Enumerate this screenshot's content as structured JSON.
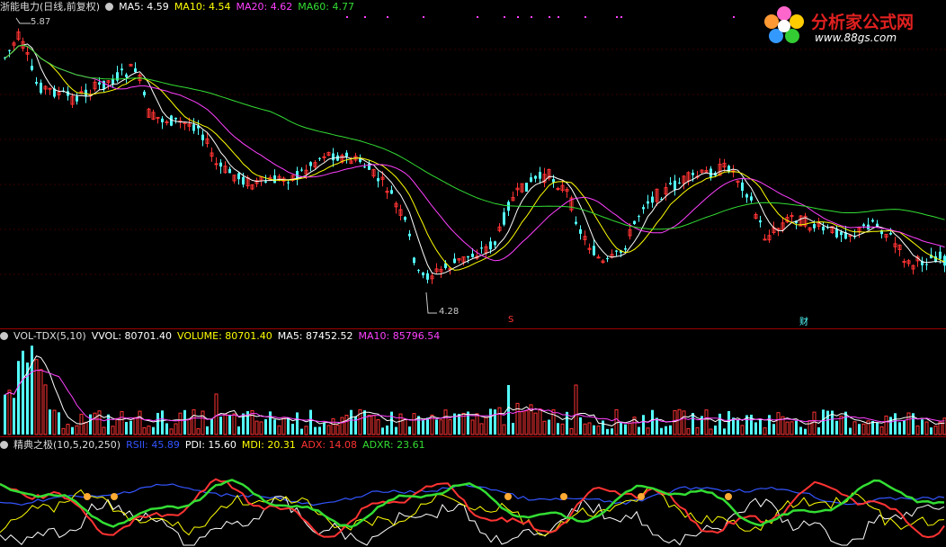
{
  "main": {
    "title": "浙能电力(日线,前复权)",
    "ma": [
      {
        "label": "MA5: 4.59",
        "color": "#ffffff"
      },
      {
        "label": "MA10: 4.54",
        "color": "#ffff00"
      },
      {
        "label": "MA20: 4.62",
        "color": "#ff40ff"
      },
      {
        "label": "MA60: 4.77",
        "color": "#33dd33"
      }
    ],
    "high_label": "5.87",
    "low_label": "4.28",
    "marker_s": "S",
    "marker_cai": "财"
  },
  "volume": {
    "title": "VOL-TDX(5,10)",
    "items": [
      {
        "label": "VVOL: 80701.40",
        "color": "#ffffff"
      },
      {
        "label": "VOLUME: 80701.40",
        "color": "#ffff00"
      },
      {
        "label": "MA5: 87452.52",
        "color": "#ffffff"
      },
      {
        "label": "MA10: 85796.54",
        "color": "#ff40ff"
      }
    ]
  },
  "indicator": {
    "title": "精典之极(10,5,20,250)",
    "items": [
      {
        "label": "RSII: 45.89",
        "color": "#3355ff"
      },
      {
        "label": "PDI: 15.60",
        "color": "#ffffff"
      },
      {
        "label": "MDI: 20.31",
        "color": "#ffff00"
      },
      {
        "label": "ADX: 14.08",
        "color": "#ff3333"
      },
      {
        "label": "ADXR: 23.61",
        "color": "#33dd33"
      }
    ]
  },
  "logo": {
    "title": "分析家公式网",
    "url": "www.88gs.com"
  },
  "colors": {
    "up": "#ff3333",
    "down": "#54ffff",
    "background": "#000000",
    "separator": "#a00000"
  }
}
